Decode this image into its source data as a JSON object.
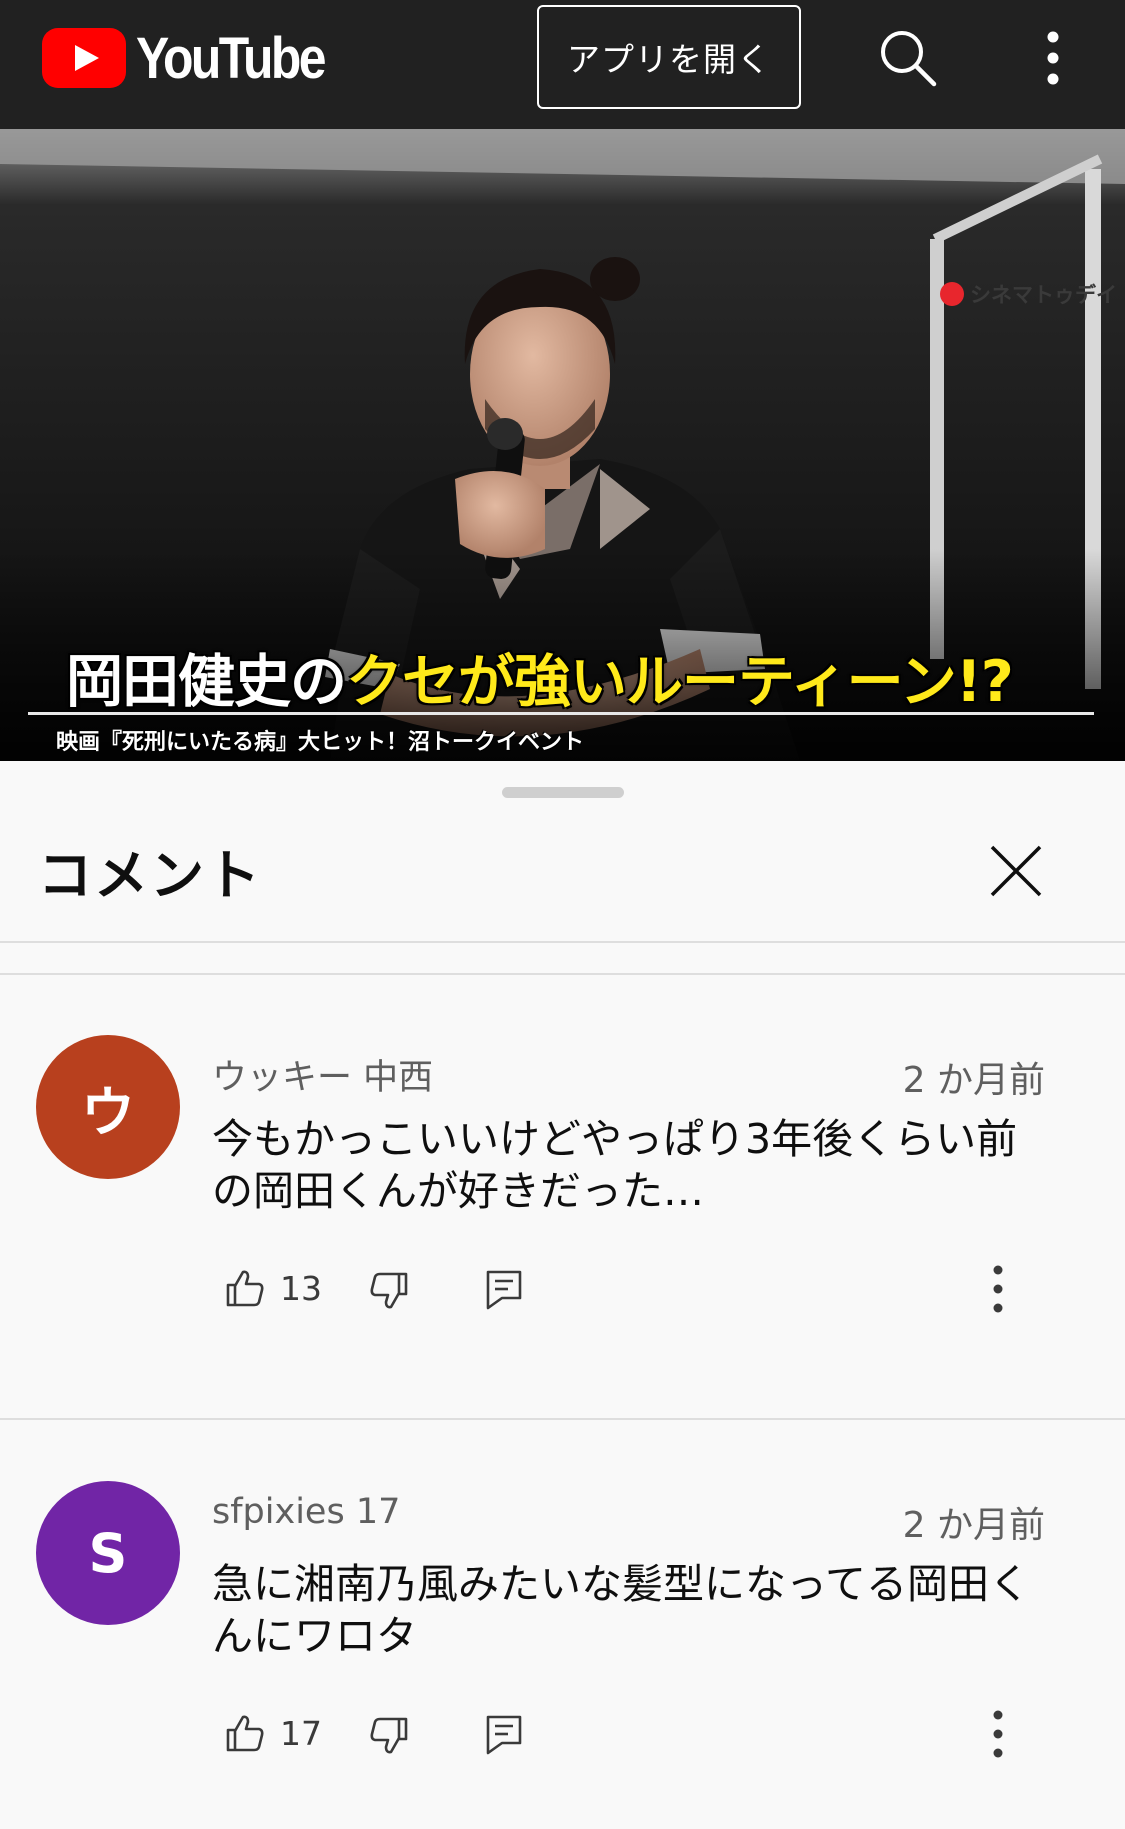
{
  "header": {
    "logo_text": "YouTube",
    "open_app_label": "アプリを開く",
    "icons": [
      "youtube-play-icon",
      "search-icon",
      "more-vert-icon"
    ]
  },
  "video": {
    "caption_white": "岡田健史の",
    "caption_yellow": "クセが強いルーティーン!?",
    "subcaption": "映画『死刑にいたる病』大ヒット！沼トークイベント",
    "watermark": "シネマトゥデイ",
    "accent_yellow": "#ffe91a"
  },
  "comments_panel": {
    "title": "コメント",
    "close_icon": "close-icon",
    "comments": [
      {
        "avatar_letter": "ウ",
        "avatar_color": "#b8401e",
        "author": "ウッキー 中西",
        "time": "2 か月前",
        "text": "今もかっこいいけどやっぱり3年後くらい前の岡田くんが好きだった…",
        "likes": "13"
      },
      {
        "avatar_letter": "S",
        "avatar_color": "#7125a6",
        "author": "sfpixies 17",
        "time": "2 か月前",
        "text": "急に湘南乃風みたいな髪型になってる岡田くんにワロタ",
        "likes": "17"
      }
    ]
  }
}
